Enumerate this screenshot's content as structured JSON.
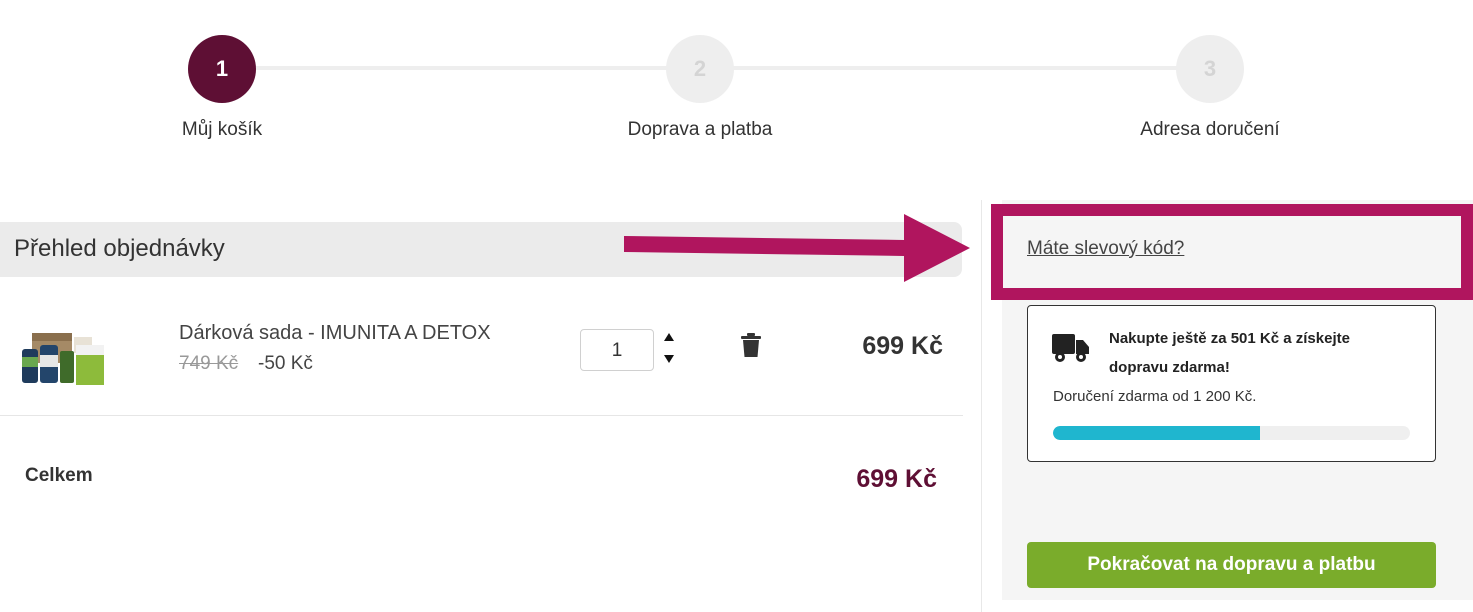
{
  "stepper": {
    "steps": [
      {
        "number": "1",
        "label": "Můj košík"
      },
      {
        "number": "2",
        "label": "Doprava a platba"
      },
      {
        "number": "3",
        "label": "Adresa doručení"
      }
    ]
  },
  "summary": {
    "title": "Přehled objednávky",
    "item": {
      "name": "Dárková sada - IMUNITA A DETOX",
      "old_price": "749 Kč",
      "discount": "-50 Kč",
      "quantity": "1",
      "price": "699 Kč"
    },
    "total_label": "Celkem",
    "total_value": "699 Kč"
  },
  "sidebar": {
    "coupon_link": "Máte slevový kód?",
    "shipping": {
      "headline": "Nakupte ještě za 501 Kč a získejte dopravu zdarma!",
      "subtext": "Doručení zdarma od 1 200 Kč.",
      "progress_fraction": 0.58
    },
    "cta_label": "Pokračovat na dopravu a platbu"
  },
  "colors": {
    "brand": "#5e0f34",
    "highlight": "#b0155e",
    "progress": "#1fb6cf",
    "cta": "#7aac2b"
  }
}
